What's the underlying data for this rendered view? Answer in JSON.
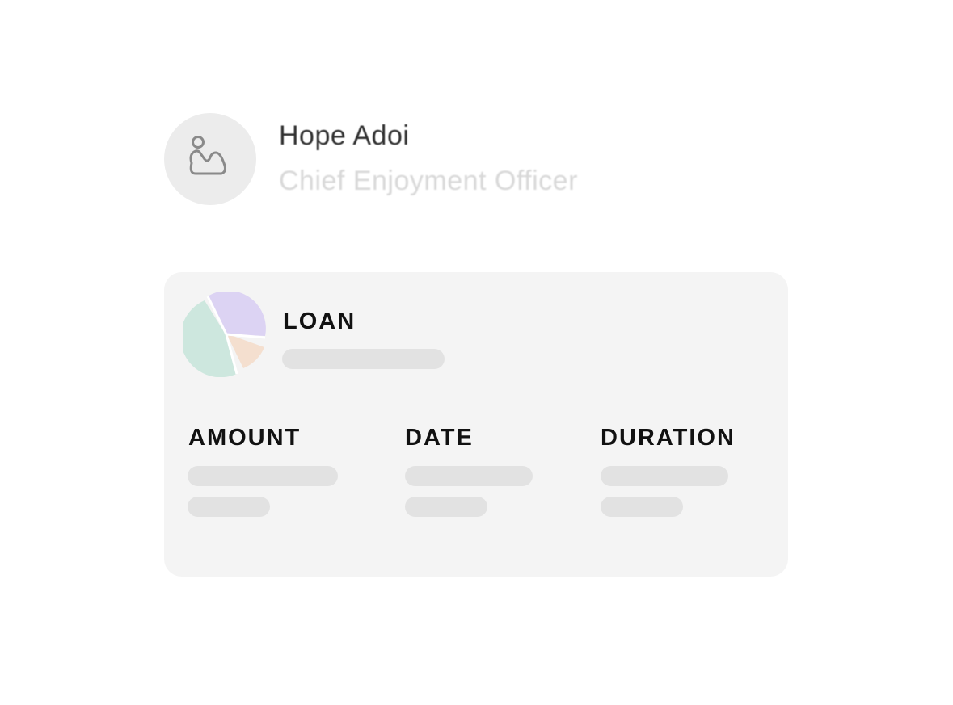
{
  "profile": {
    "avatar_icon": "image-placeholder-icon",
    "name": "Hope Adoi",
    "role": "Chief Enjoyment Officer"
  },
  "card": {
    "title": "LOAN",
    "columns": [
      {
        "label": "AMOUNT"
      },
      {
        "label": "DATE"
      },
      {
        "label": "DURATION"
      }
    ]
  },
  "colors": {
    "card_background": "#f4f4f4",
    "skeleton": "#e2e2e2",
    "pie_lavender": "#dcd3f3",
    "pie_mint": "#cde7de",
    "pie_peach": "#f4dfcf"
  },
  "icons": [
    "image-placeholder-icon",
    "pie-chart-icon"
  ]
}
